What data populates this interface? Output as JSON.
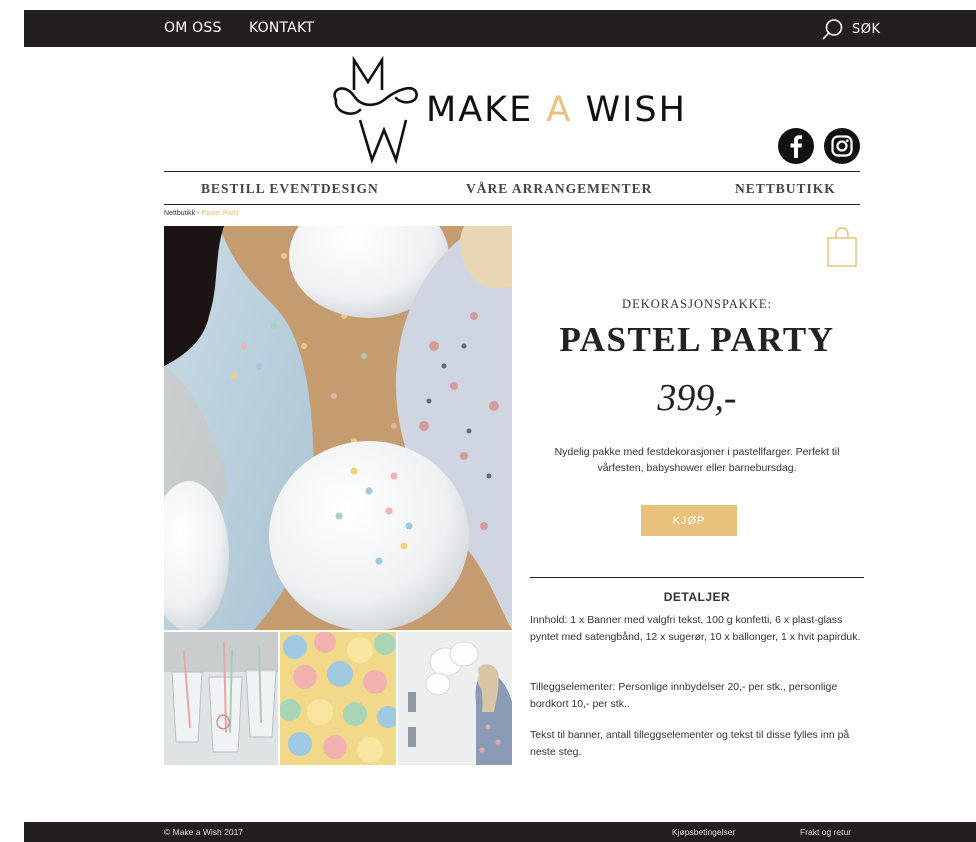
{
  "topbar": {
    "links": [
      "OM OSS",
      "KONTAKT"
    ],
    "search_label": "SØK"
  },
  "logo": {
    "word_make": "MAKE",
    "word_a": "A",
    "word_wish": "WISH"
  },
  "main_nav": [
    "BESTILL EVENTDESIGN",
    "VÅRE ARRANGEMENTER",
    "NETTBUTIKK"
  ],
  "breadcrumb": {
    "parent": "Nettbutikk",
    "separator": " - ",
    "current": "Pastel Party"
  },
  "product": {
    "eyebrow": "DEKORASJONSPAKKE:",
    "title": "PASTEL PARTY",
    "price": "399,-",
    "description": "Nydelig pakke med festdekorasjoner i pastellfarger. Perfekt til vårfesten, babyshower eller barnebursdag.",
    "buy_label": "KJØP"
  },
  "details": {
    "heading": "DETALJER",
    "paragraphs": [
      "Innhold: 1 x Banner med valgfri tekst, 100 g konfetti, 6 x plast-glass pyntet med satengbånd, 12 x sugerør, 10 x ballonger, 1 x hvit papirduk.",
      "Tilleggselementer: Personlige innbydelser 20,- per stk., personlige bordkort 10,- per stk..",
      "Tekst til banner, antall tilleggselementer og tekst til disse fylles inn på neste steg."
    ]
  },
  "footer": {
    "copyright": "© Make a Wish 2017",
    "links": [
      "Kjøpsbetingelser",
      "Frakt og retur"
    ]
  },
  "colors": {
    "accent": "#e8c27a",
    "dark": "#231f20"
  }
}
